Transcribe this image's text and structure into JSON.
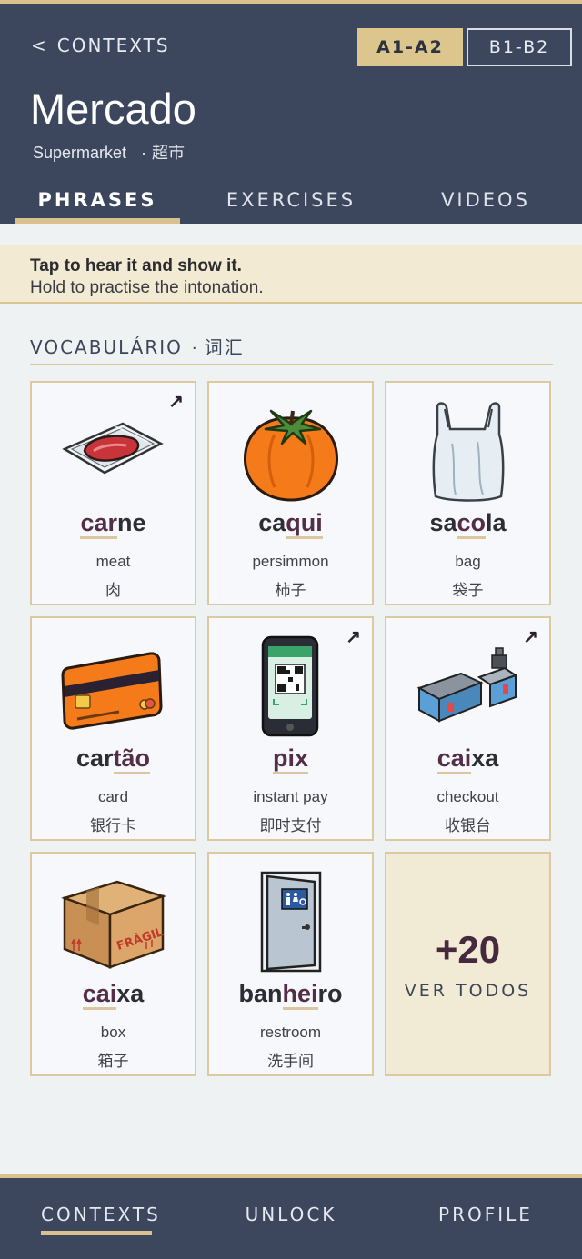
{
  "header": {
    "back_label": "CONTEXTS",
    "back_chevron": "<",
    "levels": [
      {
        "label": "A1-A2",
        "active": true
      },
      {
        "label": "B1-B2",
        "active": false
      }
    ],
    "title": "Mercado",
    "subtitle_en": "Supermarket",
    "subtitle_sep": "·",
    "subtitle_zh": "超市"
  },
  "tabs": [
    "PHRASES",
    "EXERCISES",
    "VIDEOS"
  ],
  "active_tab": "PHRASES",
  "hint": {
    "primary": "Tap to hear it and show it.",
    "secondary": "Hold to practise the intonation."
  },
  "section": {
    "title": "VOCABULÁRIO",
    "sep": "·",
    "title_zh": "词汇"
  },
  "cards": [
    {
      "pre": "",
      "hl": "car",
      "post": "ne",
      "en": "meat",
      "zh": "肉",
      "arrow": "↗",
      "icon": "meat-tray-icon"
    },
    {
      "pre": "ca",
      "hl": "qui",
      "post": "",
      "en": "persimmon",
      "zh": "柿子",
      "arrow": "",
      "icon": "persimmon-icon"
    },
    {
      "pre": "sa",
      "hl": "co",
      "post": "la",
      "en": "bag",
      "zh": "袋子",
      "arrow": "",
      "icon": "plastic-bag-icon"
    },
    {
      "pre": "car",
      "hl": "tão",
      "post": "",
      "en": "card",
      "zh": "银行卡",
      "arrow": "",
      "icon": "credit-card-icon"
    },
    {
      "pre": "",
      "hl": "pix",
      "post": "",
      "en": "instant pay",
      "zh": "即时支付",
      "arrow": "↗",
      "icon": "phone-qr-icon"
    },
    {
      "pre": "",
      "hl": "cai",
      "post": "xa",
      "en": "checkout",
      "zh": "收银台",
      "arrow": "↗",
      "icon": "checkout-counter-icon"
    },
    {
      "pre": "",
      "hl": "cai",
      "post": "xa",
      "en": "box",
      "zh": "箱子",
      "arrow": "",
      "icon": "cardboard-box-icon",
      "box_text": "FRÁGIL"
    },
    {
      "pre": "ban",
      "hl": "hei",
      "post": "ro",
      "en": "restroom",
      "zh": "洗手间",
      "arrow": "",
      "icon": "restroom-door-icon"
    }
  ],
  "more": {
    "count": "+20",
    "label": "VER TODOS"
  },
  "bottom_nav": [
    "CONTEXTS",
    "UNLOCK",
    "PROFILE"
  ],
  "colors": {
    "header_bg": "#3c475e",
    "accent_gold": "#d9c08c",
    "highlight_syllable": "#542e48",
    "hint_bg": "#f2ead2"
  }
}
